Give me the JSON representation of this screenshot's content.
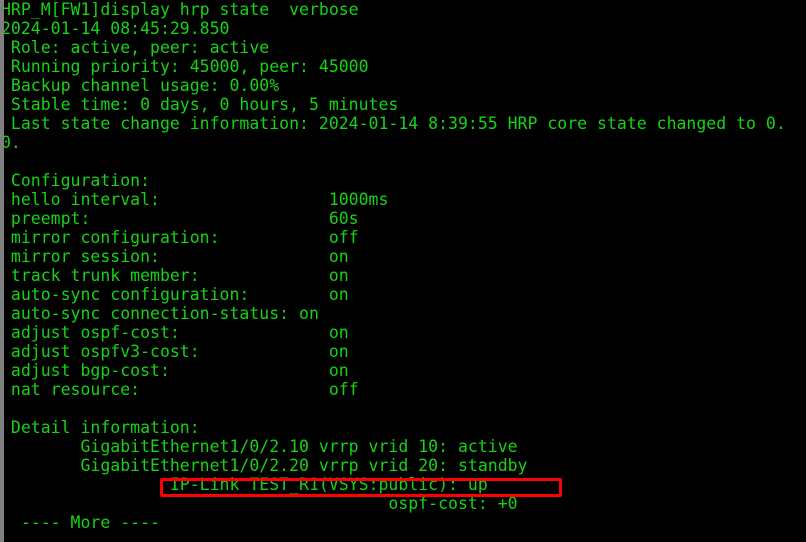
{
  "terminal": {
    "prompt_line": "HRP_M[FW1]display hrp state  verbose",
    "timestamp_line": "2024-01-14 08:45:29.850",
    "lines": [
      "HRP_M[FW1]display hrp state  verbose",
      "2024-01-14 08:45:29.850",
      " Role: active, peer: active",
      " Running priority: 45000, peer: 45000",
      " Backup channel usage: 0.00%",
      " Stable time: 0 days, 0 hours, 5 minutes",
      " Last state change information: 2024-01-14 8:39:55 HRP core state changed to 0.",
      "0.",
      "",
      " Configuration:",
      " hello interval:                 1000ms",
      " preempt:                        60s",
      " mirror configuration:           off",
      " mirror session:                 on",
      " track trunk member:             on",
      " auto-sync configuration:        on",
      " auto-sync connection-status: on",
      " adjust ospf-cost:               on",
      " adjust ospfv3-cost:             on",
      " adjust bgp-cost:                on",
      " nat resource:                   off",
      "",
      " Detail information:",
      "        GigabitEthernet1/0/2.10 vrrp vrid 10: active",
      "        GigabitEthernet1/0/2.20 vrrp vrid 20: standby",
      "                 IP-Link TEST_R1(VSYS:public): up",
      "                                       ospf-cost: +0",
      "  ---- More ----"
    ],
    "state": {
      "role": "active",
      "peer_role": "active",
      "running_priority": "45000",
      "peer_priority": "45000",
      "backup_channel_usage": "0.00%",
      "stable_time": "0 days, 0 hours, 5 minutes",
      "last_state_change": "2024-01-14 8:39:55 HRP core state changed to 0."
    },
    "configuration": {
      "header": "Configuration:",
      "rows": [
        {
          "key": "hello interval:",
          "value": "1000ms"
        },
        {
          "key": "preempt:",
          "value": "60s"
        },
        {
          "key": "mirror configuration:",
          "value": "off"
        },
        {
          "key": "mirror session:",
          "value": "on"
        },
        {
          "key": "track trunk member:",
          "value": "on"
        },
        {
          "key": "auto-sync configuration:",
          "value": "on"
        },
        {
          "key": "auto-sync connection-status:",
          "value": "on"
        },
        {
          "key": "adjust ospf-cost:",
          "value": "on"
        },
        {
          "key": "adjust ospfv3-cost:",
          "value": "on"
        },
        {
          "key": "adjust bgp-cost:",
          "value": "on"
        },
        {
          "key": "nat resource:",
          "value": "off"
        }
      ]
    },
    "detail": {
      "header": "Detail information:",
      "entries": [
        "GigabitEthernet1/0/2.10 vrrp vrid 10: active",
        "GigabitEthernet1/0/2.20 vrrp vrid 20: standby",
        "IP-Link TEST_R1(VSYS:public): up",
        "ospf-cost: +0"
      ]
    },
    "more_prompt": "  ---- More ----",
    "colors": {
      "text": "#16d316",
      "background": "#000000",
      "gutter": "#808080",
      "annotation": "#ff0000"
    }
  }
}
